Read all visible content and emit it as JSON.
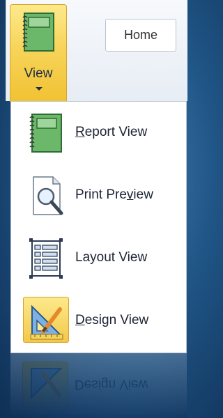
{
  "ribbon": {
    "view_button": {
      "label": "View",
      "icon": "report-view-icon"
    },
    "home_tab": {
      "label": "Home"
    }
  },
  "menu": {
    "items": [
      {
        "label_pre": "",
        "label_underlined": "R",
        "label_post": "eport View",
        "icon": "report-view-icon"
      },
      {
        "label_pre": "Print Pre",
        "label_underlined": "v",
        "label_post": "iew",
        "icon": "print-preview-icon"
      },
      {
        "label_pre": "Layout View",
        "label_underlined": "",
        "label_post": "",
        "icon": "layout-view-icon"
      },
      {
        "label_pre": "",
        "label_underlined": "D",
        "label_post": "esign View",
        "icon": "design-view-icon",
        "selected": true
      }
    ]
  },
  "reflection": {
    "label": "Design View"
  },
  "colors": {
    "background": "#1f5485",
    "highlight": "#f7d45a",
    "menu_bg": "#ffffff",
    "text": "#1c2333"
  }
}
